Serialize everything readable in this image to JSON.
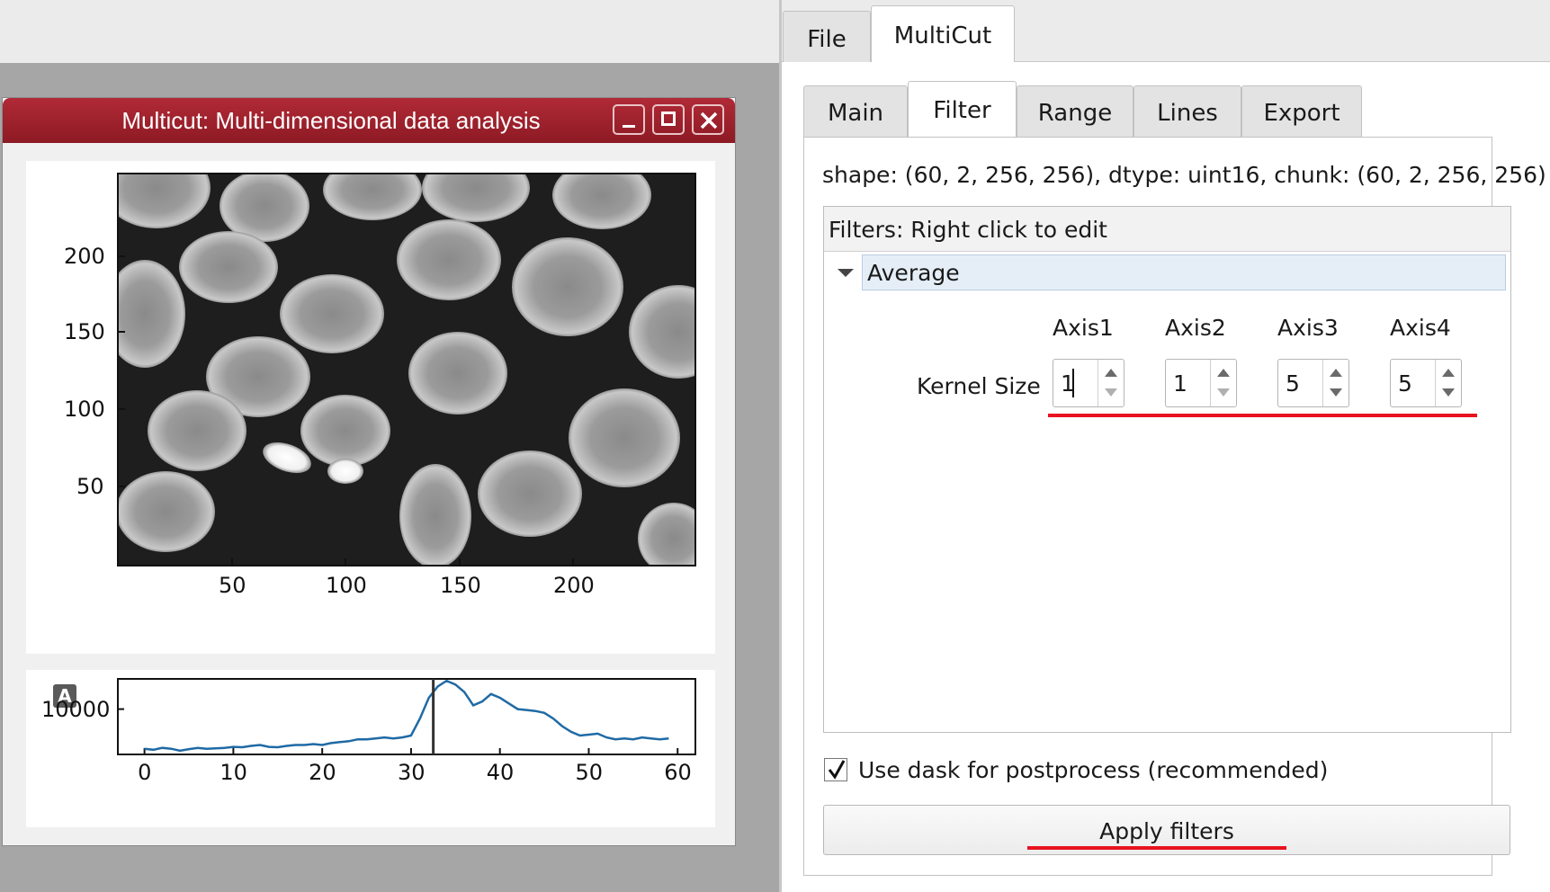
{
  "window": {
    "title": "Multicut: Multi-dimensional data analysis",
    "title_bar_color": "#9e1f2b"
  },
  "top_tabs": [
    {
      "label": "File",
      "active": false
    },
    {
      "label": "MultiCut",
      "active": true
    }
  ],
  "sub_tabs": [
    {
      "label": "Main",
      "active": false
    },
    {
      "label": "Filter",
      "active": true
    },
    {
      "label": "Range",
      "active": false
    },
    {
      "label": "Lines",
      "active": false
    },
    {
      "label": "Export",
      "active": false
    }
  ],
  "info": {
    "shape_text": "shape: (60, 2, 256, 256), dtype: uint16, chunk: (60, 2, 256, 256)"
  },
  "filters": {
    "header": "Filters: Right click to edit",
    "item": "Average",
    "axes": [
      "Axis1",
      "Axis2",
      "Axis3",
      "Axis4"
    ],
    "kernel_label": "Kernel Size",
    "kernel_values": [
      "1",
      "1",
      "5",
      "5"
    ]
  },
  "dask": {
    "checked": true,
    "label": "Use dask for postprocess (recommended)"
  },
  "apply_button": "Apply filters",
  "image_plot": {
    "x_ticks": [
      "50",
      "100",
      "150",
      "200"
    ],
    "y_ticks": [
      "200",
      "150",
      "100",
      "50"
    ],
    "colormap": "gray"
  },
  "badge": "A",
  "chart_data": {
    "type": "line",
    "x": [
      0,
      1,
      2,
      3,
      4,
      5,
      6,
      7,
      8,
      9,
      10,
      11,
      12,
      13,
      14,
      15,
      16,
      17,
      18,
      19,
      20,
      21,
      22,
      23,
      24,
      25,
      26,
      27,
      28,
      29,
      30,
      31,
      32,
      33,
      34,
      35,
      36,
      37,
      38,
      39,
      40,
      41,
      42,
      43,
      44,
      45,
      46,
      47,
      48,
      49,
      50,
      51,
      52,
      53,
      54,
      55,
      56,
      57,
      58,
      59
    ],
    "series": [
      {
        "values": [
          7900,
          7850,
          7950,
          7900,
          7800,
          7880,
          7950,
          7900,
          7920,
          7950,
          8000,
          7980,
          8050,
          8100,
          8000,
          7980,
          8050,
          8100,
          8100,
          8150,
          8100,
          8200,
          8250,
          8300,
          8400,
          8400,
          8450,
          8500,
          8450,
          8500,
          8600,
          9500,
          10600,
          11200,
          11500,
          11300,
          10900,
          10200,
          10400,
          10800,
          10600,
          10300,
          10000,
          9950,
          9900,
          9800,
          9500,
          9100,
          8800,
          8600,
          8650,
          8700,
          8500,
          8400,
          8450,
          8400,
          8500,
          8450,
          8400,
          8450
        ],
        "color": "#1f6aa5"
      }
    ],
    "x_ticks": [
      0,
      10,
      20,
      30,
      40,
      50,
      60
    ],
    "y_ticks": [
      10000
    ],
    "xlim": [
      -3,
      62
    ],
    "ylim": [
      7600,
      11600
    ],
    "cursor_x": 32.5,
    "grid": false
  }
}
